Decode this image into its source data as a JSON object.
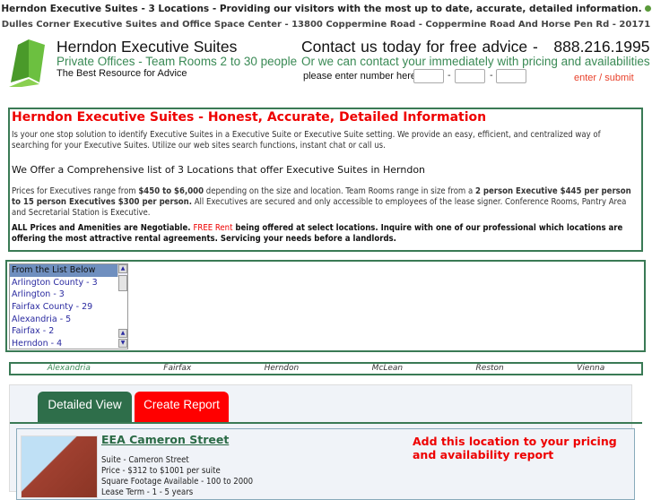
{
  "top": {
    "line1": "Herndon Executive Suites - 3 Locations - Providing our visitors with the most up to date, accurate, detailed information.",
    "line2": "Dulles Corner Executive Suites and Office Space Center - 13800 Coppermine Road - Coppermine Road And Horse Pen Rd - 20171"
  },
  "header": {
    "title": "Herndon Executive Suites",
    "subtitle": "Private Offices - Team Rooms 2 to 30 people",
    "tagline": "The Best Resource for Advice",
    "contact": "Contact us today for free advice -",
    "phone": "888.216.1995",
    "contact_sub": "Or we can contact your immediately with pricing and availabilities",
    "phone_prompt": "please enter number here",
    "dash": "-",
    "submit": "enter / submit"
  },
  "intro": {
    "heading": "Herndon Executive Suites - Honest, Accurate, Detailed Information",
    "p1": "Is your one stop solution to identify Executive Suites in a Executive Suite or Executive Suite setting. We provide an easy, efficient, and centralized way of searching for your Executive Suites. Utilize our web sites search functions, instant chat or call us.",
    "h2": "We Offer a Comprehensive list of 3 Locations that offer Executive Suites in Herndon",
    "p2a": "Prices for Executives range from ",
    "p2b": "$450 to $6,000",
    "p2c": " depending on the size and location. Team Rooms range in size from a ",
    "p2d": "2 person Executive $445 per person to 15 person Executives $300 per person.",
    "p2e": " All Executives are secured and only accessible to employees of the lease signer. Conference Rooms, Pantry Area and Secretarial Station is Executive.",
    "p3a": "ALL Prices and Amenities are Negotiable. ",
    "p3b": "FREE Rent",
    "p3c": " being offered at select locations. Inquire with one of our professional which locations are offering the most attractive rental agreements. Servicing your needs before a landlords."
  },
  "list": [
    "From the List Below",
    "Arlington County - 3",
    "Arlington - 3",
    "Fairfax County - 29",
    "Alexandria - 5",
    "Fairfax - 2",
    "Herndon - 4"
  ],
  "nav": [
    "Alexandria",
    "Fairfax",
    "Herndon",
    "McLean",
    "Reston",
    "Vienna"
  ],
  "tabs": {
    "detailed": "Detailed View",
    "report": "Create Report",
    "detailed_color": "#2e6e4a",
    "report_color": "#ff0000"
  },
  "listing": {
    "name": "EEA Cameron Street",
    "suite": "Suite - Cameron Street",
    "price": "Price - $312 to $1001 per suite",
    "sqft": "Square Footage Available - 100 to 2000",
    "lease": "Lease Term - 1 - 5 years",
    "add": "Add this location to your pricing and availability report"
  }
}
